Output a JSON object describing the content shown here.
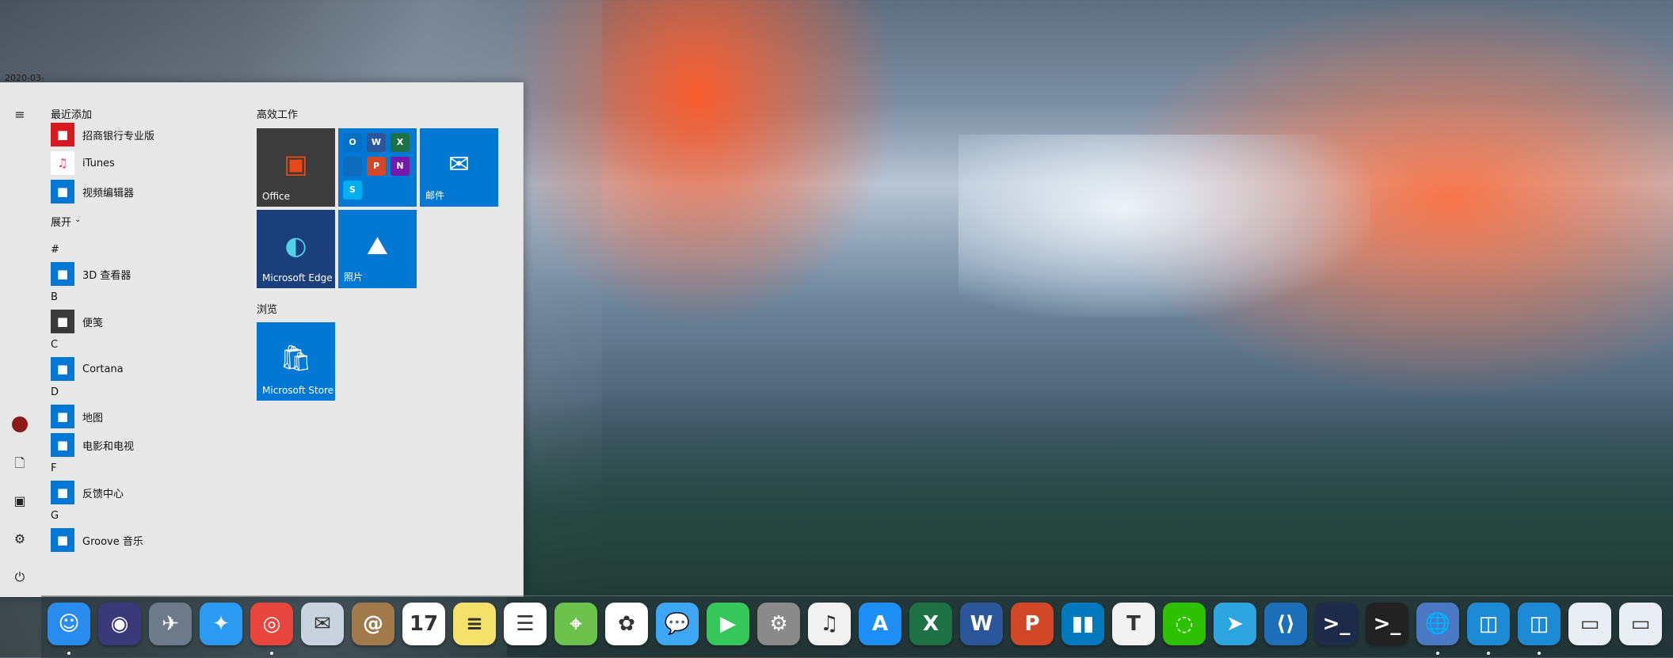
{
  "wallpaper": {
    "name": "El Capitan"
  },
  "date_fragment": "2020-03-",
  "start_menu": {
    "rail_icons": [
      "hamburger-icon",
      "avatar",
      "document-icon",
      "pictures-icon",
      "settings-icon",
      "power-icon"
    ],
    "recent_header": "最近添加",
    "recent": [
      {
        "label": "招商银行专业版",
        "icon": "cmb-icon",
        "color": "#d71920"
      },
      {
        "label": "iTunes",
        "icon": "itunes-icon",
        "color": "#ffffff"
      },
      {
        "label": "视频编辑器",
        "icon": "video-editor-icon",
        "color": "#0078d4"
      }
    ],
    "expand_label": "展开",
    "groups": [
      {
        "letter": "#",
        "apps": [
          {
            "label": "3D 查看器",
            "icon": "3d-viewer-icon",
            "color": "#0078d4"
          }
        ]
      },
      {
        "letter": "B",
        "apps": [
          {
            "label": "便笺",
            "icon": "sticky-notes-icon",
            "color": "#3a3a3a"
          }
        ]
      },
      {
        "letter": "C",
        "apps": [
          {
            "label": "Cortana",
            "icon": "cortana-icon",
            "color": "#0078d4"
          }
        ]
      },
      {
        "letter": "D",
        "apps": [
          {
            "label": "地图",
            "icon": "maps-icon",
            "color": "#0078d4"
          },
          {
            "label": "电影和电视",
            "icon": "movies-tv-icon",
            "color": "#0078d4"
          }
        ]
      },
      {
        "letter": "F",
        "apps": [
          {
            "label": "反馈中心",
            "icon": "feedback-icon",
            "color": "#0078d4"
          }
        ]
      },
      {
        "letter": "G",
        "apps": [
          {
            "label": "Groove 音乐",
            "icon": "groove-icon",
            "color": "#0078d4"
          }
        ]
      }
    ],
    "tiles_header_work": "高效工作",
    "tiles_header_browse": "浏览",
    "tiles": {
      "office": "Office",
      "mail": "邮件",
      "edge": "Microsoft Edge",
      "photos": "照片",
      "store": "Microsoft Store"
    },
    "office_minis": [
      "O",
      "W",
      "X",
      "",
      "P",
      "N",
      "S"
    ]
  },
  "dock": {
    "apps": [
      {
        "name": "finder-icon",
        "glyph": "☺",
        "color": "#2b8cf0",
        "running": true
      },
      {
        "name": "siri-icon",
        "glyph": "◉",
        "color": "#3a3a7a",
        "running": false
      },
      {
        "name": "launchpad-icon",
        "glyph": "✈",
        "color": "#6c7a89",
        "running": false
      },
      {
        "name": "safari-icon",
        "glyph": "✦",
        "color": "#2b9af3",
        "running": false
      },
      {
        "name": "chrome-icon",
        "glyph": "◎",
        "color": "#e8453c",
        "running": true
      },
      {
        "name": "mail-app-icon",
        "glyph": "✉",
        "color": "#c9d3e0",
        "running": false
      },
      {
        "name": "contacts-icon",
        "glyph": "@",
        "color": "#a07a4a",
        "running": false
      },
      {
        "name": "calendar-icon",
        "glyph": "17",
        "color": "#ffffff",
        "running": false
      },
      {
        "name": "notes-icon",
        "glyph": "≡",
        "color": "#f5e26b",
        "running": false
      },
      {
        "name": "reminders-icon",
        "glyph": "☰",
        "color": "#ffffff",
        "running": false
      },
      {
        "name": "maps-app-icon",
        "glyph": "⌖",
        "color": "#6cc24a",
        "running": false
      },
      {
        "name": "photos-app-icon",
        "glyph": "✿",
        "color": "#ffffff",
        "running": false
      },
      {
        "name": "messages-icon",
        "glyph": "💬",
        "color": "#3ea7f5",
        "running": false
      },
      {
        "name": "facetime-icon",
        "glyph": "▶",
        "color": "#35c75a",
        "running": false
      },
      {
        "name": "system-preferences-icon",
        "glyph": "⚙",
        "color": "#8a8a8a",
        "running": false
      },
      {
        "name": "music-icon",
        "glyph": "♫",
        "color": "#f2f2f2",
        "running": false
      },
      {
        "name": "app-store-icon",
        "glyph": "A",
        "color": "#1c8ef5",
        "running": false
      },
      {
        "name": "excel-icon",
        "glyph": "X",
        "color": "#1e7145",
        "running": false
      },
      {
        "name": "word-icon",
        "glyph": "W",
        "color": "#2b579a",
        "running": false
      },
      {
        "name": "powerpoint-icon",
        "glyph": "P",
        "color": "#d24726",
        "running": false
      },
      {
        "name": "trello-icon",
        "glyph": "▮▮",
        "color": "#0079bf",
        "running": false
      },
      {
        "name": "typora-icon",
        "glyph": "T",
        "color": "#f2f2f2",
        "running": false
      },
      {
        "name": "wechat-icon",
        "glyph": "◌",
        "color": "#2dc100",
        "running": false
      },
      {
        "name": "telegram-icon",
        "glyph": "➤",
        "color": "#2ca5e0",
        "running": false
      },
      {
        "name": "vscode-icon",
        "glyph": "⟨⟩",
        "color": "#1e6fba",
        "running": false
      },
      {
        "name": "powershell-icon",
        "glyph": ">_",
        "color": "#1d2a4a",
        "running": false
      },
      {
        "name": "terminal-icon",
        "glyph": ">_",
        "color": "#222222",
        "running": false
      },
      {
        "name": "network-icon",
        "glyph": "🌐",
        "color": "#4a78c4",
        "running": true
      },
      {
        "name": "vmware-icon",
        "glyph": "◫",
        "color": "#1d8ad6",
        "running": true
      },
      {
        "name": "vmware-2-icon",
        "glyph": "◫",
        "color": "#1d8ad6",
        "running": true
      },
      {
        "name": "window-icon",
        "glyph": "▭",
        "color": "#e9eef5",
        "running": false
      },
      {
        "name": "window-2-icon",
        "glyph": "▭",
        "color": "#e9eef5",
        "running": false
      }
    ]
  }
}
